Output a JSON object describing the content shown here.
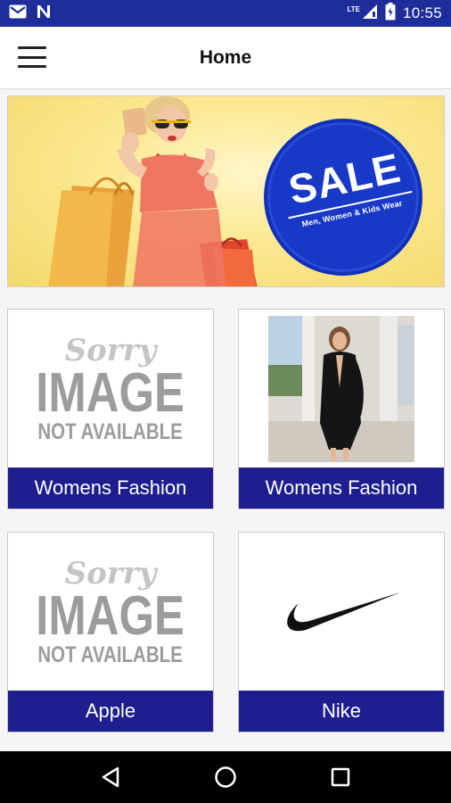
{
  "status_bar": {
    "time": "10:55",
    "network_label": "LTE",
    "icons": [
      "gmail-icon",
      "n-app-icon",
      "signal-icon",
      "battery-icon"
    ]
  },
  "app_bar": {
    "title": "Home",
    "menu_icon": "hamburger-menu-icon"
  },
  "banner": {
    "sale_text": "SALE",
    "sale_subtitle": "Men, Women & Kids Wear",
    "sale_color": "#1838c8"
  },
  "placeholder": {
    "line1": "Sorry",
    "line2": "IMAGE",
    "line3": "NOT AVAILABLE"
  },
  "categories": [
    {
      "label": "Womens Fashion",
      "image": "not-available"
    },
    {
      "label": "Womens Fashion",
      "image": "model-photo"
    },
    {
      "label": "Apple",
      "image": "not-available"
    },
    {
      "label": "Nike",
      "image": "nike-swoosh"
    }
  ],
  "colors": {
    "status_bar": "#1e2d9a",
    "card_label_bg": "#1e1e8f"
  },
  "nav_bar": {
    "icons": [
      "back-icon",
      "home-icon",
      "recents-icon"
    ]
  }
}
